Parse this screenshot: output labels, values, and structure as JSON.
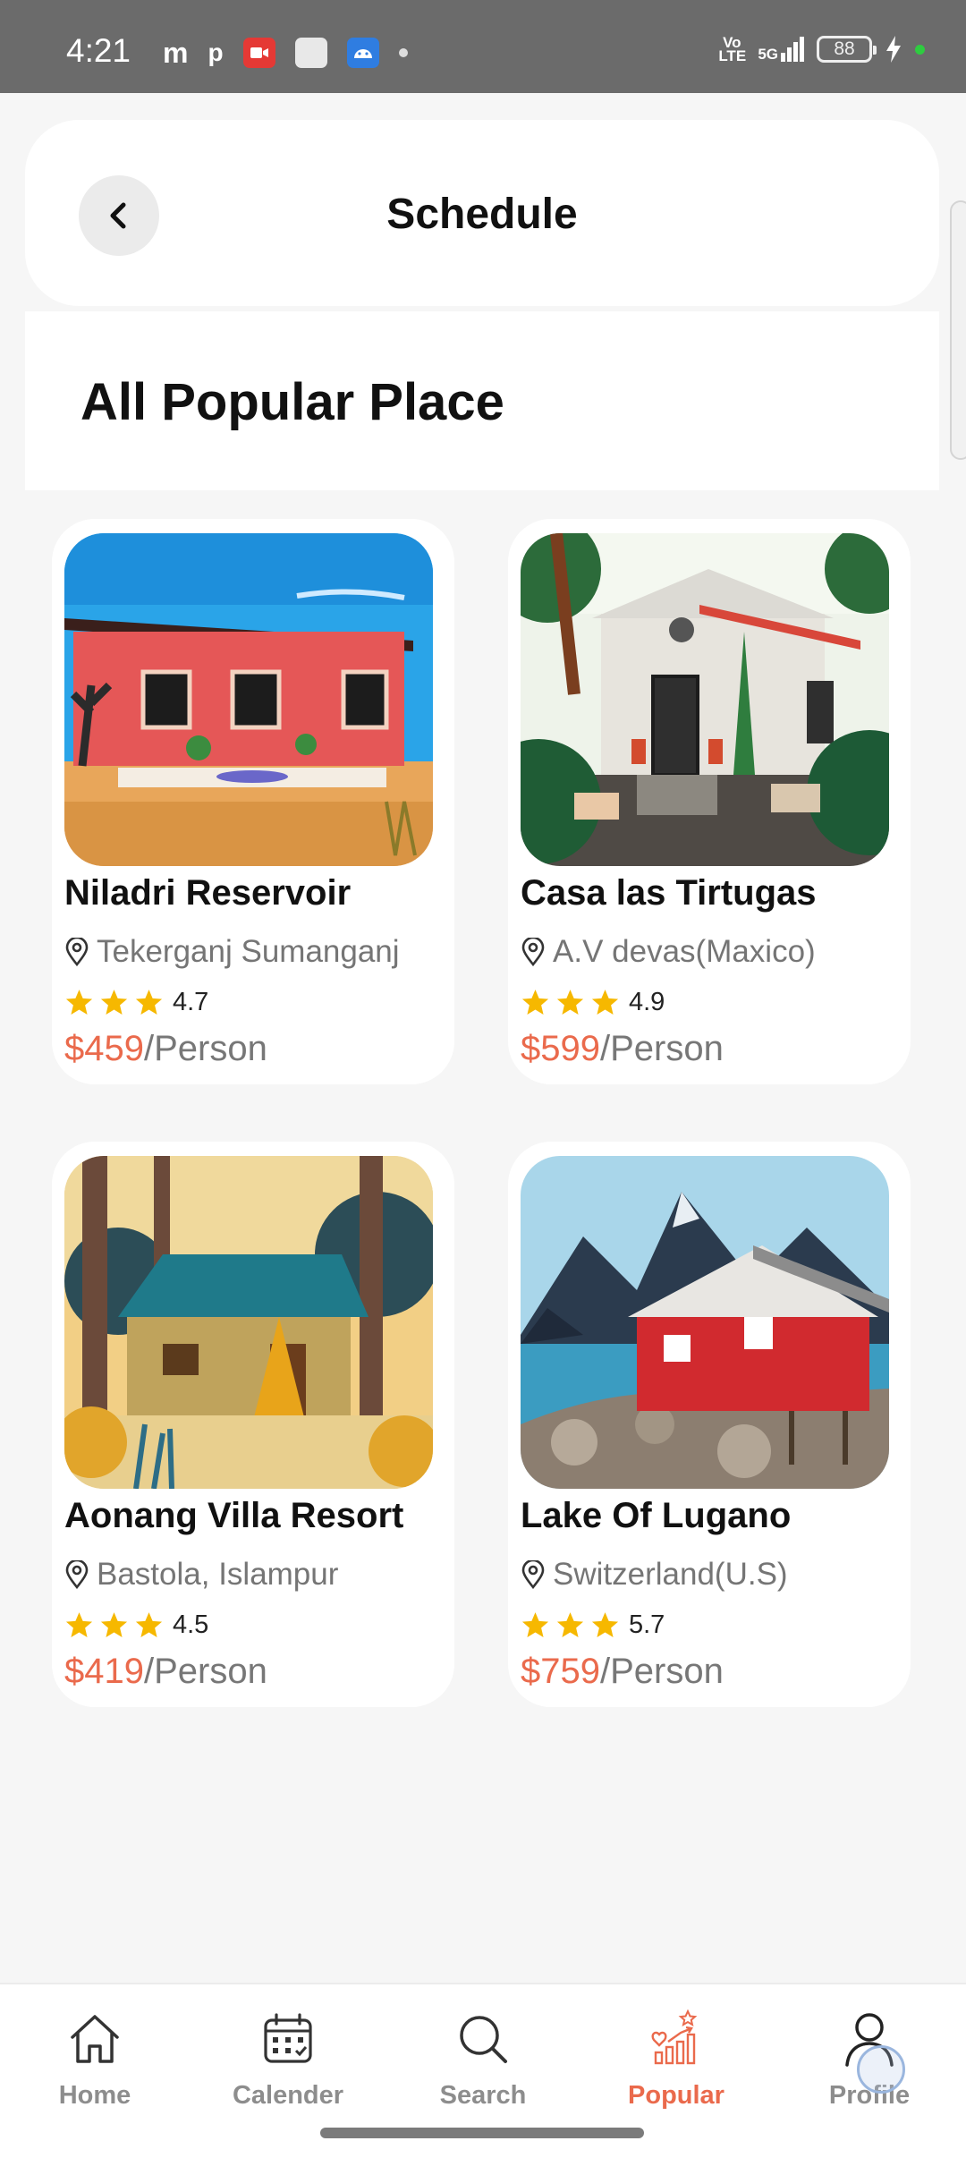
{
  "status_bar": {
    "time": "4:21",
    "left_icons": [
      "m",
      "p"
    ],
    "network_label": "5G",
    "volte_label": "Vo LTE",
    "battery_level": "88"
  },
  "header": {
    "title": "Schedule"
  },
  "section": {
    "title": "All Popular Place"
  },
  "places": [
    {
      "name": "Niladri Reservoir",
      "location": "Tekerganj Sumanganj",
      "rating": "4.7",
      "price": "$459",
      "unit": "/Person",
      "stars": 3
    },
    {
      "name": "Casa las Tirtugas",
      "location": "A.V devas(Maxico)",
      "rating": "4.9",
      "price": "$599",
      "unit": "/Person",
      "stars": 3
    },
    {
      "name": "Aonang Villa Resort",
      "location": "Bastola, Islampur",
      "rating": "4.5",
      "price": "$419",
      "unit": "/Person",
      "stars": 3
    },
    {
      "name": "Lake Of Lugano",
      "location": "Switzerland(U.S)",
      "rating": "5.7",
      "price": "$759",
      "unit": "/Person",
      "stars": 3
    }
  ],
  "nav": {
    "items": [
      {
        "label": "Home",
        "icon": "home-icon"
      },
      {
        "label": "Calender",
        "icon": "calendar-icon"
      },
      {
        "label": "Search",
        "icon": "search-icon"
      },
      {
        "label": "Popular",
        "icon": "popular-chart-icon",
        "active": true
      },
      {
        "label": "Profile",
        "icon": "profile-icon"
      }
    ]
  },
  "colors": {
    "accent": "#ea6a4c",
    "star": "#f6b800",
    "background": "#f6f6f6"
  }
}
